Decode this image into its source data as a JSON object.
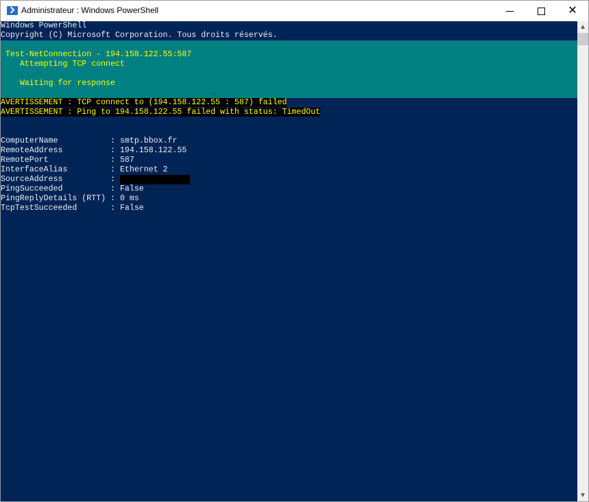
{
  "window": {
    "title": "Administrateur : Windows PowerShell",
    "icon": "powershell-icon"
  },
  "console": {
    "header": [
      "Windows PowerShell",
      "Copyright (C) Microsoft Corporation. Tous droits réservés."
    ],
    "progress": {
      "activity": " Test-NetConnection - 194.158.122.55:587",
      "status1": "    Attempting TCP connect",
      "status2": "    Waiting for response",
      "marker": "."
    },
    "warnings": [
      "AVERTISSEMENT : TCP connect to (194.158.122.55 : 587) failed",
      "AVERTISSEMENT : Ping to 194.158.122.55 failed with status: TimedOut"
    ],
    "results": [
      {
        "key": "ComputerName           ",
        "value": "smtp.bbox.fr"
      },
      {
        "key": "RemoteAddress          ",
        "value": "194.158.122.55"
      },
      {
        "key": "RemotePort             ",
        "value": "587"
      },
      {
        "key": "InterfaceAlias         ",
        "value": "Ethernet 2"
      },
      {
        "key": "SourceAddress          ",
        "value": ""
      },
      {
        "key": "PingSucceeded          ",
        "value": "False"
      },
      {
        "key": "PingReplyDetails (RTT) ",
        "value": "0 ms"
      },
      {
        "key": "TcpTestSucceeded       ",
        "value": "False"
      }
    ],
    "separator": ": "
  },
  "colors": {
    "background": "#012456",
    "progress": "#008080",
    "warning": "#ffff00"
  }
}
